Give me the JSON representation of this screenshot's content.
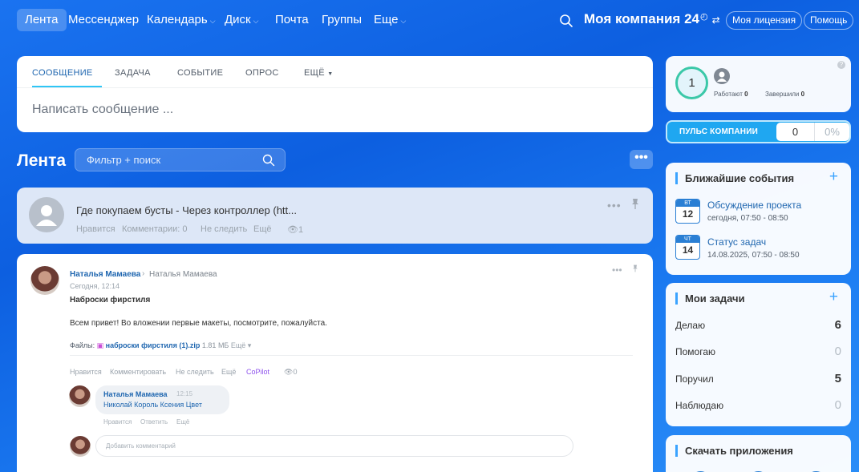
{
  "nav": {
    "items": [
      {
        "label": "Лента",
        "caret": false
      },
      {
        "label": "Мессенджер",
        "caret": false
      },
      {
        "label": "Календарь",
        "caret": true
      },
      {
        "label": "Диск",
        "caret": true
      },
      {
        "label": "Почта",
        "caret": false
      },
      {
        "label": "Группы",
        "caret": false
      },
      {
        "label": "Еще",
        "caret": true
      }
    ],
    "company": "Моя компания",
    "company_num": "24",
    "license_btn": "Моя лицензия",
    "help_btn": "Помощь"
  },
  "composer": {
    "tabs": [
      "СООБЩЕНИЕ",
      "ЗАДАЧА",
      "СОБЫТИЕ",
      "ОПРОС",
      "ЕЩЁ"
    ],
    "placeholder": "Написать сообщение ..."
  },
  "feed": {
    "title": "Лента",
    "filter_placeholder": "Фильтр + поиск",
    "more": "•••"
  },
  "pinned_post": {
    "title": "Где покупаем бусты - Через контроллер (htt...",
    "like": "Нравится",
    "comments": "Комментарии: 0",
    "unfollow": "Не следить",
    "more": "Ещё",
    "views": "1"
  },
  "post": {
    "author": "Наталья Мамаева",
    "target": "Наталья Мамаева",
    "time": "Сегодня, 12:14",
    "title": "Наброски фирстиля",
    "text": "Всем привет! Во вложении первые макеты, посмотрите, пожалуйста.",
    "files_label": "Файлы:",
    "file_name": "наброски фирстиля (1).zip",
    "file_size": "1.81 МБ",
    "file_more": "Ещё",
    "actions": {
      "like": "Нравится",
      "comment": "Комментировать",
      "unfollow": "Не следить",
      "more": "Ещё",
      "copilot": "CoPilot",
      "views": "0"
    },
    "comment": {
      "author": "Наталья Мамаева",
      "time": "12:15",
      "text": "Николай Король Ксения Цвет",
      "like": "Нравится",
      "reply": "Ответить",
      "more": "Ещё"
    },
    "comment_placeholder": "Добавить комментарий"
  },
  "workday": {
    "count": "1",
    "working_label": "Работают",
    "working_count": "0",
    "finished_label": "Завершили",
    "finished_count": "0",
    "help": "?"
  },
  "pulse": {
    "label": "ПУЛЬС КОМПАНИИ",
    "value": "0",
    "percent": "0%"
  },
  "events": {
    "title": "Ближайшие события",
    "items": [
      {
        "weekday": "ВТ",
        "day": "12",
        "title": "Обсуждение проекта",
        "time": "сегодня, 07:50 - 08:50"
      },
      {
        "weekday": "ЧТ",
        "day": "14",
        "title": "Статус задач",
        "time": "14.08.2025, 07:50 - 08:50"
      }
    ]
  },
  "tasks": {
    "title": "Мои задачи",
    "items": [
      {
        "label": "Делаю",
        "count": "6"
      },
      {
        "label": "Помогаю",
        "count": "0"
      },
      {
        "label": "Поручил",
        "count": "5"
      },
      {
        "label": "Наблюдаю",
        "count": "0"
      }
    ]
  },
  "apps": {
    "title": "Скачать приложения"
  },
  "colors": {
    "accent": "#2fc6f6",
    "link": "#2067b0",
    "copilot": "#8e52ec",
    "pulse": "#1fa7f1"
  }
}
